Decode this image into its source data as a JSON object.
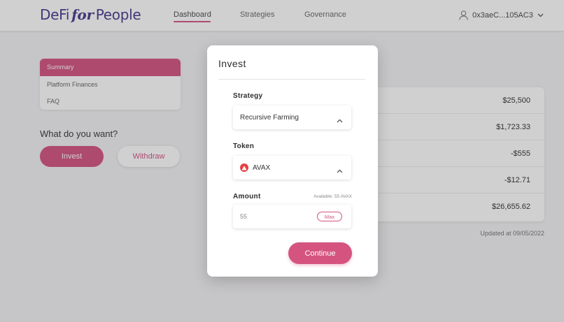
{
  "header": {
    "logo": {
      "part1": "DeFi",
      "part2": "for",
      "part3": "People"
    },
    "nav": [
      "Dashboard",
      "Strategies",
      "Governance"
    ],
    "active_nav": "Dashboard",
    "account": "0x3aeC...105AC3",
    "account_icon": "user-icon"
  },
  "sidebar": {
    "items": [
      "Summary",
      "Platform Finances",
      "FAQ"
    ],
    "active": "Summary"
  },
  "action": {
    "question": "What do you want?",
    "invest_label": "Invest",
    "withdraw_label": "Withdraw"
  },
  "summary": {
    "values": [
      "$25,500",
      "$1,723.33",
      "-$555",
      "-$12.71",
      "$26,655.62"
    ],
    "updated": "Updated at 09/05/2022"
  },
  "modal": {
    "title": "Invest",
    "strategy_label": "Strategy",
    "strategy_value": "Recursive Farming",
    "token_label": "Token",
    "token_value": "AVAX",
    "token_icon": "avax-icon",
    "amount_label": "Amount",
    "available": "Available: 55 AVAX",
    "amount_value": "55",
    "max_label": "Max",
    "continue_label": "Continue"
  },
  "colors": {
    "accent": "#d4547f",
    "brand": "#4b3a8c",
    "avax": "#e84142"
  }
}
